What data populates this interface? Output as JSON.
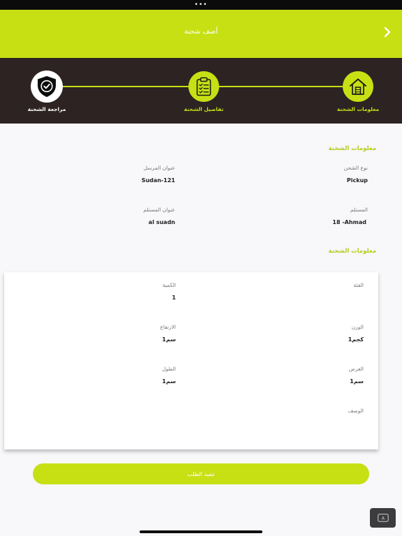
{
  "status_bar": {
    "dots": "•••"
  },
  "header": {
    "title": "أضف شحنة"
  },
  "stepper": {
    "steps": [
      {
        "label": "معلومات الشحنة",
        "icon": "house-icon"
      },
      {
        "label": "تفاصيل الشحنة",
        "icon": "clipboard-checklist-icon"
      },
      {
        "label": "مراجعة الشحنة",
        "icon": "shield-check-icon",
        "active": true
      }
    ]
  },
  "shipment_info": {
    "title": "معلومات الشحنة",
    "shipping_type_label": "نوع الشحن",
    "shipping_type_value": "Pickup",
    "sender_address_label": "عنوان المرسل",
    "sender_address_value": "Sudan-121",
    "receiver_label": "المستلم",
    "receiver_value": "18 -Ahmad",
    "receiver_address_label": "عنوان المستلم",
    "receiver_address_value": "al suadn"
  },
  "shipment_details": {
    "title": "معلومات الشحنة",
    "category_label": "الفئة",
    "category_value": "",
    "quantity_label": "الكمية",
    "quantity_value": "1",
    "weight_label": "الوزن",
    "weight_value": "1كجم",
    "height_label": "الارتفاع",
    "height_value": "1سم",
    "width_label": "العرض",
    "width_value": "1سم",
    "length_label": "الطول",
    "length_value": "1سم",
    "description_label": "الوصف",
    "description_value": ""
  },
  "actions": {
    "confirm_label": "تنفيذ الطلب"
  },
  "keyboard": {
    "label": "A"
  },
  "colors": {
    "accent": "#c6e014",
    "stepper_bg": "#2c2322",
    "background": "#f8f7f9"
  }
}
